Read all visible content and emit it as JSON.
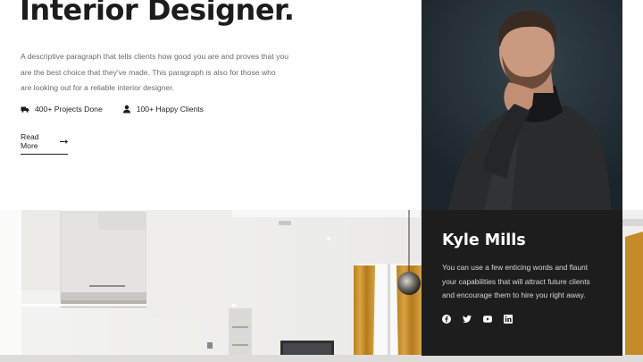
{
  "hero": {
    "title": "Interior Designer.",
    "description": "A descriptive paragraph that tells clients how good you are and proves that you are the best choice that they've made. This paragraph is also for those who are looking out for a reliable interior designer.",
    "stats": [
      {
        "icon": "truck-icon",
        "label": "400+ Projects Done"
      },
      {
        "icon": "user-icon",
        "label": "100+ Happy Clients"
      }
    ],
    "read_more_label": "Read More",
    "read_more_icon": "arrow-right-icon"
  },
  "profile_card": {
    "name": "Kyle Mills",
    "bio": "You can use a few enticing words and flaunt your capabilities that will attract future clients and encourage them to hire you right away.",
    "socials": [
      "facebook-icon",
      "twitter-icon",
      "youtube-icon",
      "linkedin-icon"
    ]
  },
  "colors": {
    "heading": "#1c1c1c",
    "body_text": "#6b6b6b",
    "card_background": "#1d1d1d",
    "portrait_background": "#243038",
    "curtain": "#c9912c"
  }
}
